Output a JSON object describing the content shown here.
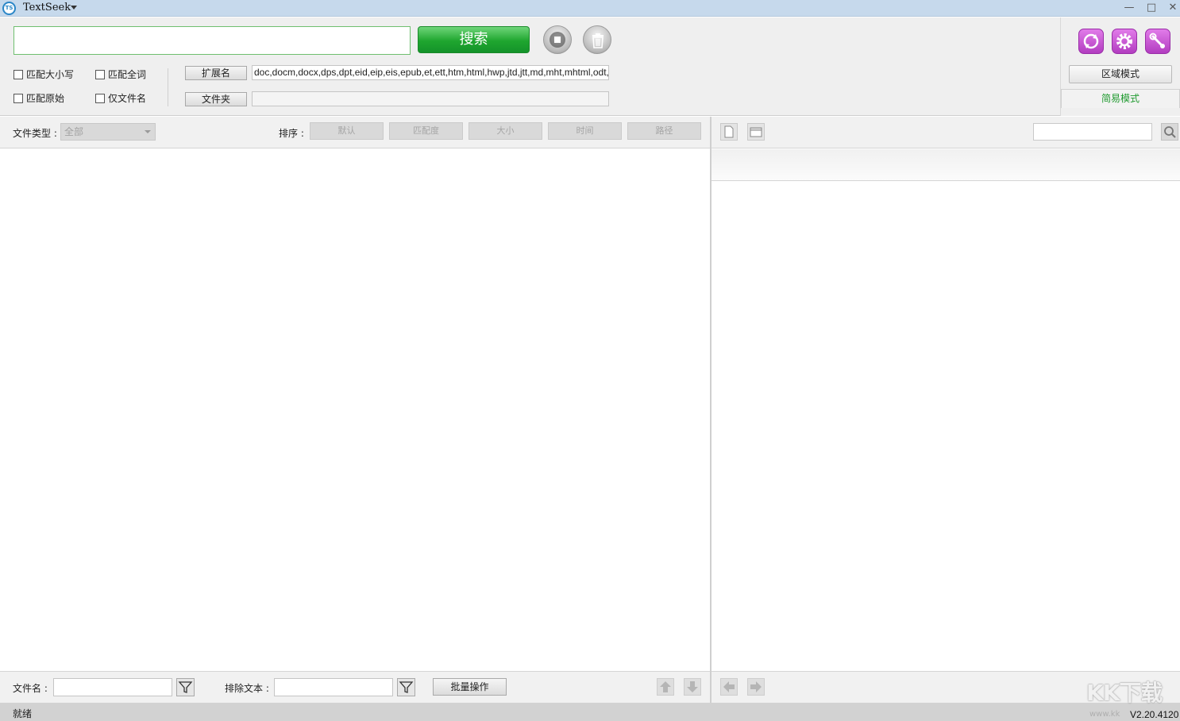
{
  "window": {
    "title": "TextSeek",
    "logo_text": "TS",
    "minimize": "—",
    "maximize": "□",
    "close": "✕"
  },
  "search": {
    "query": "",
    "button_label": "搜索"
  },
  "options": {
    "match_case": "匹配大小写",
    "match_whole_word": "匹配全词",
    "match_original": "匹配原始",
    "filename_only": "仅文件名"
  },
  "filters": {
    "extension_button": "扩展名",
    "extension_value": "doc,docm,docx,dps,dpt,eid,eip,eis,epub,et,ett,htm,html,hwp,jtd,jtt,md,mht,mhtml,odt,ods,odp,pdf,ppt,pptx,rtf,txt,wps,xls,xlsx",
    "folder_button": "文件夹",
    "folder_value": ""
  },
  "mode": {
    "region_mode": "区域模式",
    "simple_mode": "简易模式"
  },
  "list_toolbar": {
    "filetype_label": "文件类型 :",
    "filetype_value": "全部",
    "sort_label": "排序 :",
    "sort_options": [
      "默认",
      "匹配度",
      "大小",
      "时间",
      "路径"
    ]
  },
  "bottom": {
    "filename_label": "文件名 :",
    "exclude_label": "排除文本 :",
    "batch_button": "批量操作"
  },
  "status": {
    "text": "就绪",
    "version": "V2.20.4120",
    "watermark": "KK下载",
    "watermark_url": "www.kk"
  },
  "colors": {
    "accent_green": "#1fa62f",
    "tool_purple": "#b23dc0",
    "titlebar": "#c6d9ec"
  }
}
